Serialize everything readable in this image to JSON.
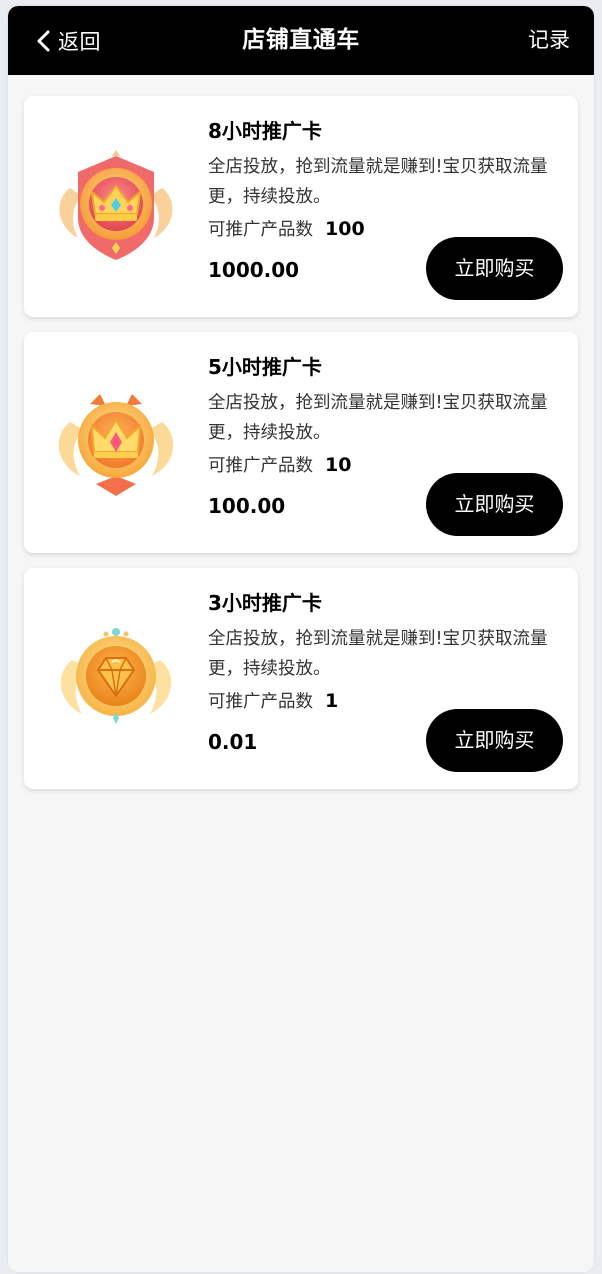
{
  "header": {
    "back_label": "返回",
    "title": "店铺直通车",
    "record_label": "记录"
  },
  "cards": [
    {
      "title": "8小时推广卡",
      "description": "全店投放，抢到流量就是赚到!宝贝获取流量更，持续投放。",
      "count_label": "可推广产品数",
      "count": "100",
      "price": "1000.00",
      "button_label": "立即购买",
      "icon": "crown-badge-icon"
    },
    {
      "title": "5小时推广卡",
      "description": "全店投放，抢到流量就是赚到!宝贝获取流量更，持续投放。",
      "count_label": "可推广产品数",
      "count": "10",
      "price": "100.00",
      "button_label": "立即购买",
      "icon": "gold-crown-badge-icon"
    },
    {
      "title": "3小时推广卡",
      "description": "全店投放，抢到流量就是赚到!宝贝获取流量更，持续投放。",
      "count_label": "可推广产品数",
      "count": "1",
      "price": "0.01",
      "button_label": "立即购买",
      "icon": "diamond-badge-icon"
    }
  ],
  "colors": {
    "navbar_bg": "#000000",
    "page_bg": "#f6f6f7",
    "card_bg": "#ffffff",
    "button_bg": "#000000"
  }
}
